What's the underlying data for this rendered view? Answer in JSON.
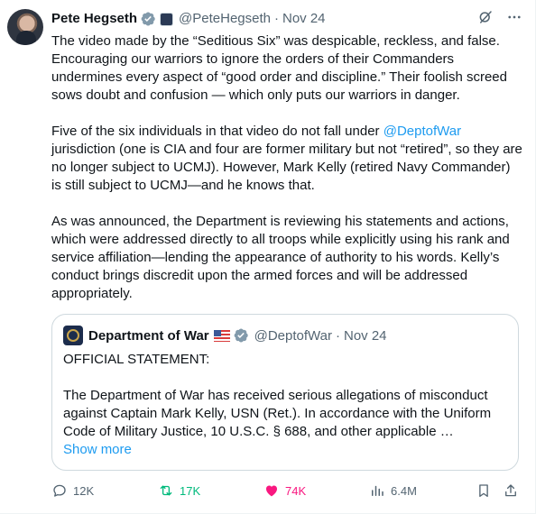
{
  "author": {
    "name": "Pete Hegseth",
    "handle": "@PeteHegseth",
    "date": "Nov 24"
  },
  "tweet": {
    "p1": "The video made by the “Seditious Six” was despicable, reckless, and false. Encouraging our warriors to ignore the orders of their Commanders undermines every aspect of “good order and discipline.” Their foolish screed sows doubt and confusion — which only puts our warriors in danger.",
    "p2_before": "Five of the six individuals in that video do not fall under ",
    "p2_mention": "@DeptofWar",
    "p2_after": " jurisdiction (one is CIA and four are former military but not “retired”, so they are no longer subject to UCMJ). However, Mark Kelly (retired Navy Commander) is still subject to UCMJ—and he knows that.",
    "p3": "As was announced, the Department is reviewing his statements and actions, which were addressed directly to all troops while explicitly using his rank and service affiliation—lending the appearance of authority to his words. Kelly’s conduct brings discredit upon the armed forces and will be addressed appropriately."
  },
  "quote": {
    "name": "Department of War",
    "handle": "@DeptofWar",
    "date": "Nov 24",
    "line1": "OFFICIAL STATEMENT:",
    "line2": "The Department of War has received serious allegations of misconduct against Captain Mark Kelly, USN (Ret.). In accordance with the Uniform Code of Military Justice, 10 U.S.C. § 688, and other applicable …",
    "show_more": "Show more"
  },
  "actions": {
    "replies": "12K",
    "reposts": "17K",
    "likes": "74K",
    "views": "6.4M"
  },
  "colors": {
    "accent": "#1d9bf0",
    "repost": "#00ba7c",
    "like": "#f91880",
    "muted": "#536471"
  },
  "icons": [
    "verified-badge-icon",
    "grok-icon",
    "more-icon",
    "reply-icon",
    "repost-icon",
    "heart-icon",
    "views-icon",
    "bookmark-icon",
    "share-icon",
    "us-flag-icon"
  ]
}
